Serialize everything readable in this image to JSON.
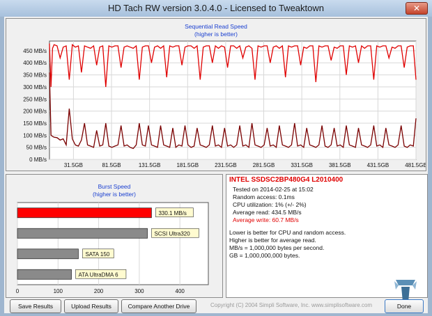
{
  "window": {
    "title": "HD Tach RW version 3.0.4.0 - Licensed to Tweaktown",
    "close_glyph": "✕"
  },
  "seq_chart": {
    "title": "Sequential Read Speed",
    "subtitle": "(higher is better)",
    "chart_data": {
      "type": "line",
      "title": "Sequential Read Speed",
      "subtitle": "(higher is better)",
      "y_ticks": [
        "0 MB/s",
        "50 MB/s",
        "100 MB/s",
        "150 MB/s",
        "200 MB/s",
        "250 MB/s",
        "300 MB/s",
        "350 MB/s",
        "400 MB/s",
        "450 MB/s"
      ],
      "x_ticks": [
        "31.5GB",
        "81.5GB",
        "131.5GB",
        "181.5GB",
        "231.5GB",
        "281.5GB",
        "331.5GB",
        "381.5GB",
        "431.5GB",
        "481.5GB"
      ],
      "xlim": [
        0,
        481.5
      ],
      "ylim": [
        0,
        490
      ],
      "series": [
        {
          "color": "#e00000",
          "x": [
            0,
            2,
            4,
            6,
            10,
            14,
            18,
            22,
            26,
            30,
            34,
            38,
            42,
            46,
            50,
            54,
            58,
            62,
            66,
            70,
            74,
            78,
            82,
            86,
            90,
            94,
            98,
            102,
            106,
            110,
            114,
            118,
            122,
            126,
            130,
            134,
            138,
            142,
            146,
            150,
            154,
            158,
            162,
            166,
            170,
            174,
            178,
            182,
            186,
            190,
            194,
            198,
            202,
            206,
            210,
            214,
            218,
            222,
            226,
            230,
            234,
            238,
            242,
            246,
            250,
            254,
            258,
            262,
            266,
            270,
            274,
            278,
            282,
            286,
            290,
            294,
            298,
            302,
            306,
            310,
            314,
            318,
            322,
            326,
            330,
            334,
            338,
            342,
            346,
            350,
            354,
            358,
            362,
            366,
            370,
            374,
            378,
            382,
            386,
            390,
            394,
            398,
            402,
            406,
            410,
            414,
            418,
            422,
            426,
            430,
            434,
            438,
            442,
            446,
            450,
            454,
            458,
            462,
            466,
            470,
            474,
            478,
            481.5
          ],
          "values": [
            480,
            300,
            460,
            475,
            470,
            420,
            465,
            470,
            330,
            475,
            465,
            470,
            360,
            470,
            465,
            460,
            470,
            390,
            465,
            470,
            300,
            470,
            465,
            470,
            470,
            380,
            465,
            470,
            465,
            460,
            470,
            330,
            465,
            470,
            470,
            400,
            465,
            470,
            460,
            470,
            340,
            470,
            465,
            470,
            470,
            390,
            465,
            470,
            470,
            460,
            470,
            330,
            465,
            470,
            470,
            400,
            470,
            460,
            470,
            465,
            380,
            470,
            470,
            460,
            470,
            420,
            465,
            470,
            460,
            330,
            470,
            465,
            470,
            470,
            400,
            465,
            470,
            460,
            470,
            340,
            470,
            465,
            470,
            470,
            390,
            465,
            460,
            470,
            470,
            320,
            470,
            465,
            470,
            470,
            410,
            465,
            460,
            470,
            470,
            350,
            470,
            465,
            470,
            400,
            470,
            460,
            470,
            470,
            330,
            470,
            465,
            470,
            470,
            420,
            465,
            460,
            470,
            470,
            380,
            465,
            470,
            470,
            330
          ]
        },
        {
          "color": "#7a0000",
          "x": [
            0,
            2,
            4,
            6,
            10,
            14,
            18,
            22,
            26,
            30,
            34,
            38,
            42,
            46,
            50,
            54,
            58,
            62,
            66,
            70,
            74,
            78,
            82,
            86,
            90,
            94,
            98,
            102,
            106,
            110,
            114,
            118,
            122,
            126,
            130,
            134,
            138,
            142,
            146,
            150,
            154,
            158,
            162,
            166,
            170,
            174,
            178,
            182,
            186,
            190,
            194,
            198,
            202,
            206,
            210,
            214,
            218,
            222,
            226,
            230,
            234,
            238,
            242,
            246,
            250,
            254,
            258,
            262,
            266,
            270,
            274,
            278,
            282,
            286,
            290,
            294,
            298,
            302,
            306,
            310,
            314,
            318,
            322,
            326,
            330,
            334,
            338,
            342,
            346,
            350,
            354,
            358,
            362,
            366,
            370,
            374,
            378,
            382,
            386,
            390,
            394,
            398,
            402,
            406,
            410,
            414,
            418,
            422,
            426,
            430,
            434,
            438,
            442,
            446,
            450,
            454,
            458,
            462,
            466,
            470,
            474,
            478,
            481.5
          ],
          "values": [
            360,
            100,
            95,
            92,
            90,
            80,
            85,
            60,
            210,
            85,
            60,
            55,
            80,
            150,
            60,
            55,
            50,
            120,
            55,
            60,
            150,
            55,
            50,
            55,
            60,
            140,
            55,
            60,
            50,
            45,
            60,
            150,
            60,
            55,
            140,
            60,
            55,
            50,
            140,
            60,
            55,
            50,
            130,
            50,
            60,
            55,
            140,
            60,
            50,
            55,
            130,
            60,
            55,
            50,
            60,
            140,
            55,
            60,
            50,
            130,
            55,
            60,
            50,
            60,
            140,
            55,
            60,
            50,
            150,
            60,
            55,
            50,
            60,
            130,
            55,
            60,
            50,
            140,
            60,
            55,
            50,
            60,
            150,
            55,
            60,
            50,
            130,
            60,
            55,
            50,
            60,
            140,
            55,
            50,
            60,
            130,
            55,
            60,
            50,
            140,
            60,
            55,
            50,
            130,
            60,
            55,
            50,
            60,
            140,
            55,
            60,
            50,
            130,
            60,
            55,
            50,
            60,
            140,
            55,
            50,
            60,
            55,
            170
          ]
        }
      ]
    }
  },
  "burst_chart": {
    "title": "Burst Speed",
    "subtitle": "(higher is better)",
    "chart_data": {
      "type": "bar",
      "title": "Burst Speed",
      "subtitle": "(higher is better)",
      "categories": [
        "330.1 MB/s",
        "SCSI Ultra320",
        "SATA 150",
        "ATA UltraDMA 6"
      ],
      "values": [
        330.1,
        320,
        150,
        133
      ],
      "colors": [
        "#ff0000",
        "#8a8a8a",
        "#8a8a8a",
        "#8a8a8a"
      ],
      "x_ticks": [
        "0",
        "100",
        "200",
        "300",
        "400"
      ],
      "xlim": [
        0,
        470
      ]
    }
  },
  "info": {
    "drive_name": "INTEL SSDSC2BP480G4 L2010400",
    "tested_on": "Tested on 2014-02-25 at 15:02",
    "random_access": "Random access: 0.1ms",
    "cpu_utilization": "CPU utilization: 1% (+/- 2%)",
    "average_read": "Average read: 434.5 MB/s",
    "average_write": "Average write: 60.7 MB/s",
    "notes": [
      "Lower is better for CPU and random access.",
      "Higher is better for average read.",
      "MB/s = 1,000,000 bytes per second.",
      "GB = 1,000,000,000 bytes."
    ]
  },
  "buttons": {
    "save": "Save Results",
    "upload": "Upload Results",
    "compare": "Compare Another Drive",
    "done": "Done"
  },
  "copyright": "Copyright (C) 2004 Simpli Software, Inc. www.simplisoftware.com",
  "colors": {
    "read_line": "#e00000",
    "write_line": "#7a0000",
    "panel_title": "#1a3fd0",
    "drive_name": "#e00000"
  }
}
